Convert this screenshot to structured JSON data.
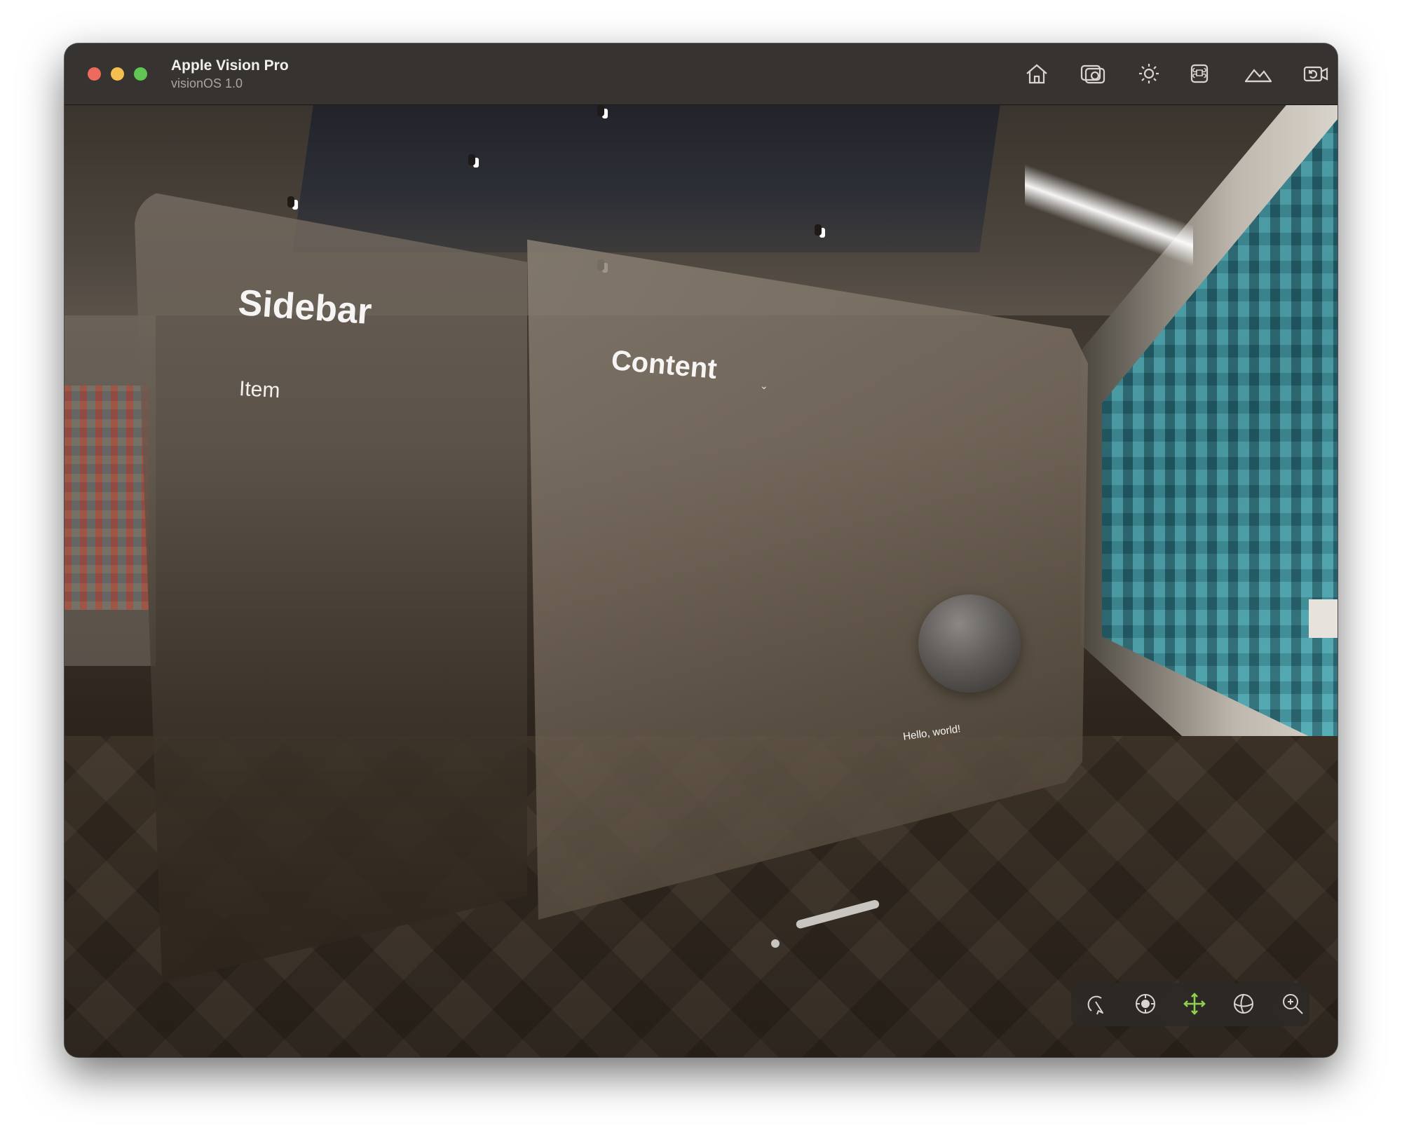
{
  "window": {
    "title": "Apple Vision Pro",
    "subtitle": "visionOS 1.0"
  },
  "toolbar_icons": [
    "home-icon",
    "camera-icon",
    "brightness-icon",
    "command-icon",
    "mountains-icon",
    "camera-rotate-icon"
  ],
  "app": {
    "sidebar_title": "Sidebar",
    "sidebar_item": "Item",
    "content_title": "Content",
    "hello_text": "Hello, world!"
  },
  "bottom_toolbar_icons": [
    "tap-icon",
    "orbit-icon",
    "pan-icon",
    "rotate-sphere-icon",
    "zoom-icon"
  ],
  "colors": {
    "active_tool": "#8fd14f",
    "close": "#ed6a5e",
    "minimize": "#f5bf4f",
    "maximize": "#61c554"
  }
}
